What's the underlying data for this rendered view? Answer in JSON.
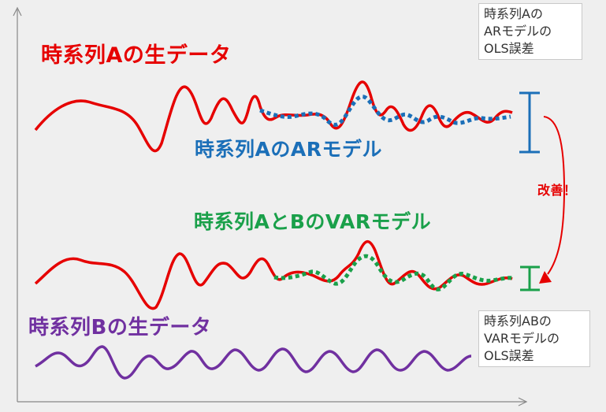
{
  "titles": {
    "series_a_raw": "時系列Aの生データ",
    "series_a_ar": "時系列AのARモデル",
    "series_ab_var": "時系列AとBのVARモデル",
    "series_b_raw": "時系列Bの生データ"
  },
  "notes": {
    "ar_error": [
      "時系列Aの",
      "ARモデルの",
      "OLS誤差"
    ],
    "var_error": [
      "時系列ABの",
      "VARモデルの",
      "OLS誤差"
    ]
  },
  "improvement_label": "改善！",
  "colors": {
    "series_a": "#e60000",
    "ar_model": "#1b6fb8",
    "var_model": "#1aa04a",
    "series_b": "#7030a0",
    "axes": "#888888",
    "background": "#efefef"
  }
}
